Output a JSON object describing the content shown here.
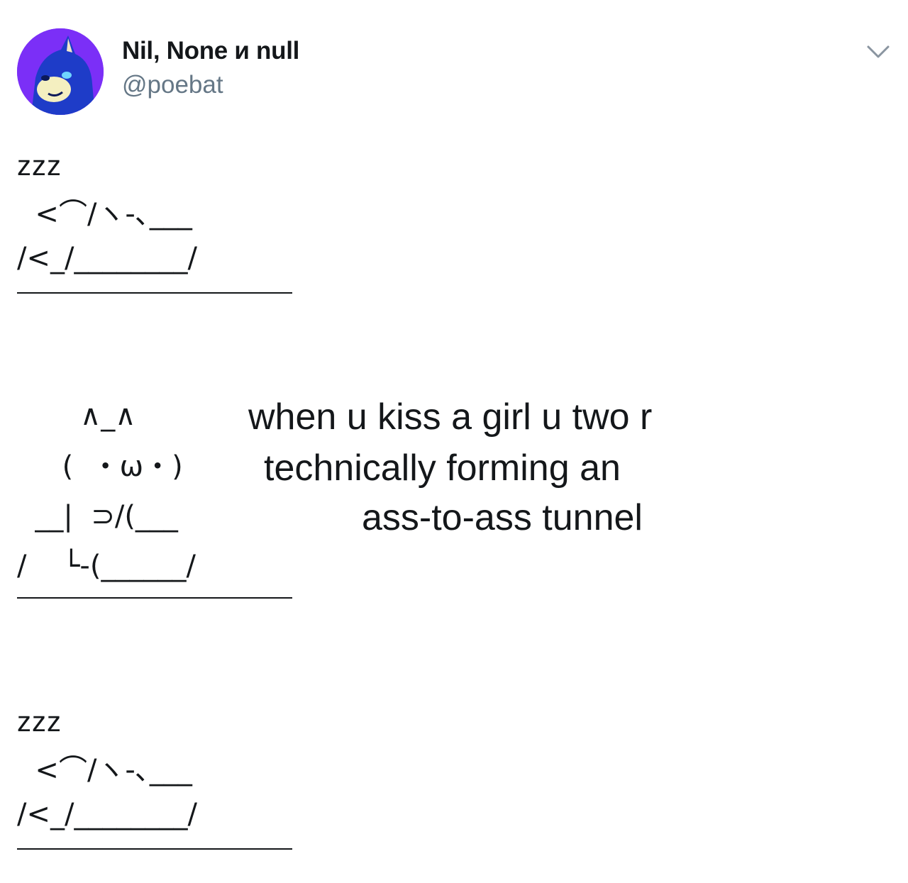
{
  "tweet": {
    "author": {
      "display_name": "Nil, None и null",
      "handle": "@poebat",
      "avatar_icon": "blue-hedgehog-avatar"
    },
    "menu_icon": "chevron-down-icon",
    "body": {
      "sleep_label_top": "zzz",
      "sleep_art_top": [
        "  <⌒/ヽ-､___",
        "/<_/________/"
      ],
      "kiss_art": [
        "       ∧_∧",
        "     (  ・ω・)",
        "  __|  ⊃/(___",
        "/    └-(______/"
      ],
      "caption": [
        "when u kiss a girl u two r",
        "technically forming an",
        "ass-to-ass tunnel"
      ],
      "sleep_label_bottom": "zzz",
      "sleep_art_bottom": [
        "  <⌒/ヽ-､___",
        "/<_/________/"
      ]
    }
  },
  "colors": {
    "text": "#14171a",
    "handle": "#657786",
    "avatar_bg": "#7b2ff7",
    "avatar_character": "#1e3cc8"
  }
}
